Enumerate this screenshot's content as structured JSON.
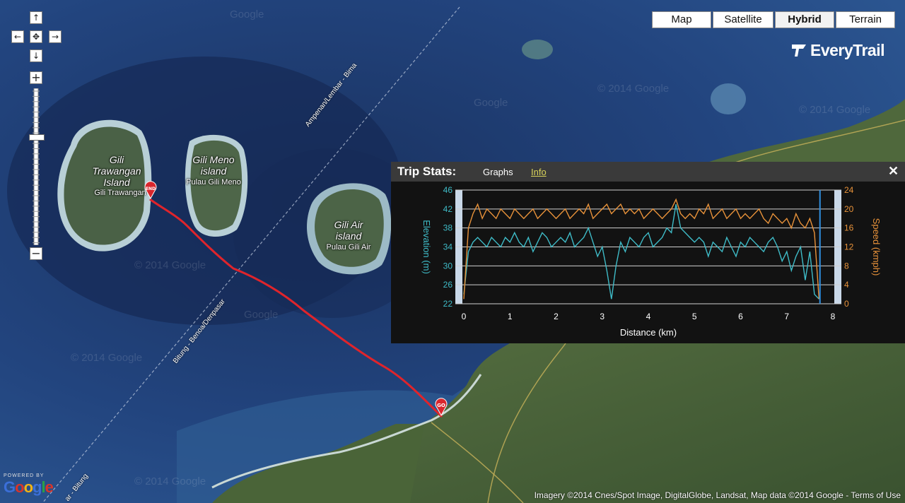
{
  "map_type_buttons": [
    {
      "label": "Map",
      "active": false
    },
    {
      "label": "Satellite",
      "active": false
    },
    {
      "label": "Hybrid",
      "active": true
    },
    {
      "label": "Terrain",
      "active": false
    }
  ],
  "brand": {
    "name": "EveryTrail",
    "icon": "everytrail-logo-icon"
  },
  "pan_controls": {
    "up": "↑",
    "down": "↓",
    "left": "←",
    "right": "→",
    "center": "✥"
  },
  "zoom_controls": {
    "in": "+",
    "out": "−",
    "level_fraction": 0.31
  },
  "places": [
    {
      "name": "Gili Trawangan Island",
      "line1": "Gili",
      "line2": "Trawangan",
      "line3": "Island",
      "local": "Gili Trawangan"
    },
    {
      "name": "Gili Meno island",
      "line1": "Gili Meno",
      "line2": "island",
      "local": "Pulau Gili Meno"
    },
    {
      "name": "Gili Air island",
      "line1": "Gili Air",
      "line2": "island",
      "local": "Pulau Gili Air"
    }
  ],
  "ferry_routes": [
    {
      "label": "Ampenan/Lembar - Bima"
    },
    {
      "label": "Bitung - Benoa/Denpasar"
    },
    {
      "label": "ar - Bitung"
    }
  ],
  "markers": {
    "start": "GO",
    "end": "END"
  },
  "watermark": "© 2014 Google",
  "watermark_short": "Google",
  "trip_stats": {
    "title": "Trip Stats:",
    "tabs": [
      "Graphs",
      "Info"
    ],
    "active_tab": "Graphs",
    "close": "✕"
  },
  "chart_data": {
    "type": "line",
    "xlabel": "Distance (km)",
    "ylabel_left": "Elevation (m)",
    "ylabel_right": "Speed (kmph)",
    "xlim": [
      0,
      8
    ],
    "x_ticks": [
      "0",
      "1",
      "2",
      "3",
      "4",
      "5",
      "6",
      "7",
      "8"
    ],
    "ylim_left": [
      22,
      46
    ],
    "ylim_right": [
      0,
      24
    ],
    "y_ticks_left": [
      "46",
      "42",
      "38",
      "34",
      "30",
      "26",
      "22"
    ],
    "y_ticks_right": [
      "24",
      "20",
      "16",
      "12",
      "8",
      "4",
      "0"
    ],
    "grid": true,
    "series": [
      {
        "name": "Elevation (m)",
        "axis": "left",
        "color": "#3fbcc8",
        "x": [
          0.0,
          0.1,
          0.2,
          0.3,
          0.4,
          0.5,
          0.6,
          0.7,
          0.8,
          0.9,
          1.0,
          1.1,
          1.2,
          1.3,
          1.4,
          1.5,
          1.6,
          1.7,
          1.8,
          1.9,
          2.0,
          2.1,
          2.2,
          2.3,
          2.4,
          2.5,
          2.6,
          2.7,
          2.8,
          2.9,
          3.0,
          3.1,
          3.2,
          3.3,
          3.4,
          3.5,
          3.6,
          3.7,
          3.8,
          3.9,
          4.0,
          4.1,
          4.2,
          4.3,
          4.4,
          4.5,
          4.6,
          4.7,
          4.8,
          4.9,
          5.0,
          5.1,
          5.2,
          5.3,
          5.4,
          5.5,
          5.6,
          5.7,
          5.8,
          5.9,
          6.0,
          6.1,
          6.2,
          6.3,
          6.4,
          6.5,
          6.6,
          6.7,
          6.8,
          6.9,
          7.0,
          7.1,
          7.2,
          7.3,
          7.4,
          7.5,
          7.6,
          7.7
        ],
        "y": [
          24,
          33,
          35,
          36,
          35,
          34,
          36,
          35,
          34,
          36,
          35,
          37,
          35,
          34,
          36,
          33,
          35,
          37,
          36,
          34,
          35,
          36,
          35,
          37,
          34,
          35,
          36,
          38,
          35,
          32,
          34,
          29,
          23,
          30,
          35,
          33,
          36,
          35,
          34,
          36,
          37,
          34,
          35,
          36,
          38,
          37,
          43,
          38,
          37,
          36,
          35,
          36,
          35,
          32,
          35,
          34,
          33,
          36,
          34,
          32,
          35,
          34,
          36,
          35,
          34,
          33,
          35,
          36,
          34,
          31,
          33,
          29,
          32,
          34,
          27,
          33,
          24,
          23
        ]
      },
      {
        "name": "Speed (kmph)",
        "axis": "right",
        "color": "#e8923a",
        "x": [
          0.0,
          0.1,
          0.2,
          0.3,
          0.4,
          0.5,
          0.6,
          0.7,
          0.8,
          0.9,
          1.0,
          1.1,
          1.2,
          1.3,
          1.4,
          1.5,
          1.6,
          1.7,
          1.8,
          1.9,
          2.0,
          2.1,
          2.2,
          2.3,
          2.4,
          2.5,
          2.6,
          2.7,
          2.8,
          2.9,
          3.0,
          3.1,
          3.2,
          3.3,
          3.4,
          3.5,
          3.6,
          3.7,
          3.8,
          3.9,
          4.0,
          4.1,
          4.2,
          4.3,
          4.4,
          4.5,
          4.6,
          4.7,
          4.8,
          4.9,
          5.0,
          5.1,
          5.2,
          5.3,
          5.4,
          5.5,
          5.6,
          5.7,
          5.8,
          5.9,
          6.0,
          6.1,
          6.2,
          6.3,
          6.4,
          6.5,
          6.6,
          6.7,
          6.8,
          6.9,
          7.0,
          7.1,
          7.2,
          7.3,
          7.4,
          7.5,
          7.6,
          7.7
        ],
        "y": [
          1,
          16,
          19,
          21,
          18,
          20,
          19,
          18,
          20,
          19,
          18,
          20,
          19,
          18,
          19,
          20,
          18,
          19,
          20,
          19,
          18,
          19,
          20,
          18,
          19,
          20,
          19,
          21,
          18,
          19,
          20,
          21,
          19,
          20,
          21,
          19,
          20,
          19,
          20,
          18,
          19,
          20,
          19,
          18,
          19,
          20,
          22,
          19,
          18,
          19,
          18,
          20,
          19,
          21,
          18,
          19,
          20,
          18,
          19,
          20,
          18,
          19,
          18,
          19,
          20,
          18,
          17,
          19,
          18,
          17,
          18,
          16,
          19,
          17,
          16,
          18,
          15,
          1
        ]
      }
    ],
    "cursor_x": 7.72
  },
  "attribution": {
    "text": "Imagery ©2014  Cnes/Spot Image, DigitalGlobe, Landsat, Map data ©2014  Google - ",
    "terms": "Terms of Use"
  },
  "google_logo": {
    "powered": "POWERED BY",
    "word": "Google"
  },
  "colors": {
    "ocean_deep": "#1b3566",
    "ocean_mid": "#244b8a",
    "reef": "#8bb3c9",
    "land": "#3e5a34",
    "route": "#e0242b",
    "panel_bg": "#121212",
    "elevation": "#3fbcc8",
    "speed": "#e8923a"
  }
}
